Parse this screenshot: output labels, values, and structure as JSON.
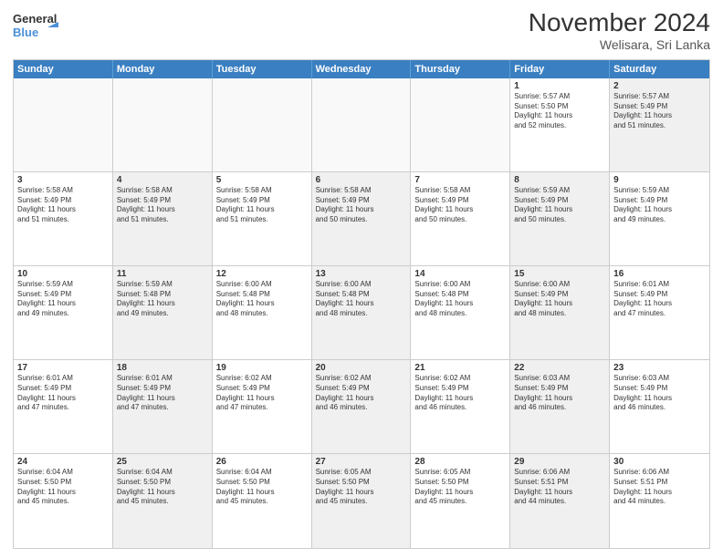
{
  "header": {
    "logo_line1": "General",
    "logo_line2": "Blue",
    "title": "November 2024",
    "subtitle": "Welisara, Sri Lanka"
  },
  "weekdays": [
    "Sunday",
    "Monday",
    "Tuesday",
    "Wednesday",
    "Thursday",
    "Friday",
    "Saturday"
  ],
  "rows": [
    [
      {
        "day": "",
        "info": "",
        "empty": true
      },
      {
        "day": "",
        "info": "",
        "empty": true
      },
      {
        "day": "",
        "info": "",
        "empty": true
      },
      {
        "day": "",
        "info": "",
        "empty": true
      },
      {
        "day": "",
        "info": "",
        "empty": true
      },
      {
        "day": "1",
        "info": "Sunrise: 5:57 AM\nSunset: 5:50 PM\nDaylight: 11 hours\nand 52 minutes.",
        "alt": false
      },
      {
        "day": "2",
        "info": "Sunrise: 5:57 AM\nSunset: 5:49 PM\nDaylight: 11 hours\nand 51 minutes.",
        "alt": true
      }
    ],
    [
      {
        "day": "3",
        "info": "Sunrise: 5:58 AM\nSunset: 5:49 PM\nDaylight: 11 hours\nand 51 minutes.",
        "alt": false
      },
      {
        "day": "4",
        "info": "Sunrise: 5:58 AM\nSunset: 5:49 PM\nDaylight: 11 hours\nand 51 minutes.",
        "alt": true
      },
      {
        "day": "5",
        "info": "Sunrise: 5:58 AM\nSunset: 5:49 PM\nDaylight: 11 hours\nand 51 minutes.",
        "alt": false
      },
      {
        "day": "6",
        "info": "Sunrise: 5:58 AM\nSunset: 5:49 PM\nDaylight: 11 hours\nand 50 minutes.",
        "alt": true
      },
      {
        "day": "7",
        "info": "Sunrise: 5:58 AM\nSunset: 5:49 PM\nDaylight: 11 hours\nand 50 minutes.",
        "alt": false
      },
      {
        "day": "8",
        "info": "Sunrise: 5:59 AM\nSunset: 5:49 PM\nDaylight: 11 hours\nand 50 minutes.",
        "alt": true
      },
      {
        "day": "9",
        "info": "Sunrise: 5:59 AM\nSunset: 5:49 PM\nDaylight: 11 hours\nand 49 minutes.",
        "alt": false
      }
    ],
    [
      {
        "day": "10",
        "info": "Sunrise: 5:59 AM\nSunset: 5:49 PM\nDaylight: 11 hours\nand 49 minutes.",
        "alt": false
      },
      {
        "day": "11",
        "info": "Sunrise: 5:59 AM\nSunset: 5:48 PM\nDaylight: 11 hours\nand 49 minutes.",
        "alt": true
      },
      {
        "day": "12",
        "info": "Sunrise: 6:00 AM\nSunset: 5:48 PM\nDaylight: 11 hours\nand 48 minutes.",
        "alt": false
      },
      {
        "day": "13",
        "info": "Sunrise: 6:00 AM\nSunset: 5:48 PM\nDaylight: 11 hours\nand 48 minutes.",
        "alt": true
      },
      {
        "day": "14",
        "info": "Sunrise: 6:00 AM\nSunset: 5:48 PM\nDaylight: 11 hours\nand 48 minutes.",
        "alt": false
      },
      {
        "day": "15",
        "info": "Sunrise: 6:00 AM\nSunset: 5:49 PM\nDaylight: 11 hours\nand 48 minutes.",
        "alt": true
      },
      {
        "day": "16",
        "info": "Sunrise: 6:01 AM\nSunset: 5:49 PM\nDaylight: 11 hours\nand 47 minutes.",
        "alt": false
      }
    ],
    [
      {
        "day": "17",
        "info": "Sunrise: 6:01 AM\nSunset: 5:49 PM\nDaylight: 11 hours\nand 47 minutes.",
        "alt": false
      },
      {
        "day": "18",
        "info": "Sunrise: 6:01 AM\nSunset: 5:49 PM\nDaylight: 11 hours\nand 47 minutes.",
        "alt": true
      },
      {
        "day": "19",
        "info": "Sunrise: 6:02 AM\nSunset: 5:49 PM\nDaylight: 11 hours\nand 47 minutes.",
        "alt": false
      },
      {
        "day": "20",
        "info": "Sunrise: 6:02 AM\nSunset: 5:49 PM\nDaylight: 11 hours\nand 46 minutes.",
        "alt": true
      },
      {
        "day": "21",
        "info": "Sunrise: 6:02 AM\nSunset: 5:49 PM\nDaylight: 11 hours\nand 46 minutes.",
        "alt": false
      },
      {
        "day": "22",
        "info": "Sunrise: 6:03 AM\nSunset: 5:49 PM\nDaylight: 11 hours\nand 46 minutes.",
        "alt": true
      },
      {
        "day": "23",
        "info": "Sunrise: 6:03 AM\nSunset: 5:49 PM\nDaylight: 11 hours\nand 46 minutes.",
        "alt": false
      }
    ],
    [
      {
        "day": "24",
        "info": "Sunrise: 6:04 AM\nSunset: 5:50 PM\nDaylight: 11 hours\nand 45 minutes.",
        "alt": false
      },
      {
        "day": "25",
        "info": "Sunrise: 6:04 AM\nSunset: 5:50 PM\nDaylight: 11 hours\nand 45 minutes.",
        "alt": true
      },
      {
        "day": "26",
        "info": "Sunrise: 6:04 AM\nSunset: 5:50 PM\nDaylight: 11 hours\nand 45 minutes.",
        "alt": false
      },
      {
        "day": "27",
        "info": "Sunrise: 6:05 AM\nSunset: 5:50 PM\nDaylight: 11 hours\nand 45 minutes.",
        "alt": true
      },
      {
        "day": "28",
        "info": "Sunrise: 6:05 AM\nSunset: 5:50 PM\nDaylight: 11 hours\nand 45 minutes.",
        "alt": false
      },
      {
        "day": "29",
        "info": "Sunrise: 6:06 AM\nSunset: 5:51 PM\nDaylight: 11 hours\nand 44 minutes.",
        "alt": true
      },
      {
        "day": "30",
        "info": "Sunrise: 6:06 AM\nSunset: 5:51 PM\nDaylight: 11 hours\nand 44 minutes.",
        "alt": false
      }
    ]
  ]
}
